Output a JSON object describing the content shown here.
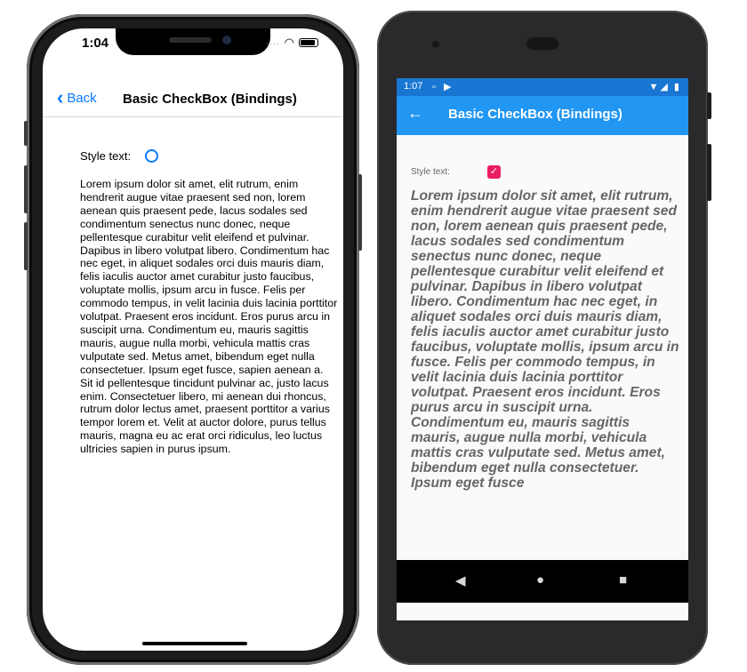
{
  "ios": {
    "status": {
      "time": "1:04"
    },
    "nav": {
      "back_label": "Back",
      "title": "Basic CheckBox (Bindings)"
    },
    "form": {
      "label": "Style text:",
      "checked": false
    },
    "body_text": "Lorem ipsum dolor sit amet, elit rutrum, enim hendrerit augue vitae praesent sed non, lorem aenean quis praesent pede, lacus sodales sed condimentum senectus nunc donec, neque pellentesque curabitur velit eleifend et pulvinar. Dapibus in libero volutpat libero. Condimentum hac nec eget, in aliquet sodales orci duis mauris diam, felis iaculis auctor amet curabitur justo faucibus, voluptate mollis, ipsum arcu in fusce. Felis per commodo tempus, in velit lacinia duis lacinia porttitor volutpat. Praesent eros incidunt. Eros purus arcu in suscipit urna. Condimentum eu, mauris sagittis mauris, augue nulla morbi, vehicula mattis cras vulputate sed. Metus amet, bibendum eget nulla consectetuer. Ipsum eget fusce, sapien aenean a. Sit id pellentesque tincidunt pulvinar ac, justo lacus enim. Consectetuer libero, mi aenean dui rhoncus, rutrum dolor lectus amet, praesent porttitor a varius tempor lorem et. Velit at auctor dolore, purus tellus mauris, magna eu ac erat orci ridiculus, leo luctus ultricies sapien in purus ipsum.",
    "colors": {
      "accent": "#0a7aff"
    }
  },
  "android": {
    "status": {
      "time": "1:07",
      "notif_icons": "▫ ▶",
      "right_icons": "▼◢ ▮"
    },
    "toolbar": {
      "back_icon": "←",
      "title": "Basic CheckBox (Bindings)"
    },
    "form": {
      "label": "Style text:",
      "checked": true,
      "check_glyph": "✓"
    },
    "body_text": "Lorem ipsum dolor sit amet, elit rutrum, enim hendrerit augue vitae praesent sed non, lorem aenean quis praesent pede, lacus sodales sed condimentum senectus nunc donec, neque pellentesque curabitur velit eleifend et pulvinar. Dapibus in libero volutpat libero. Condimentum hac nec eget, in aliquet sodales orci duis mauris diam, felis iaculis auctor amet curabitur justo faucibus, voluptate mollis, ipsum arcu in fusce. Felis per commodo tempus, in velit lacinia duis lacinia porttitor volutpat. Praesent eros incidunt. Eros purus arcu in suscipit urna. Condimentum eu, mauris sagittis mauris, augue nulla morbi, vehicula mattis cras vulputate sed. Metus amet, bibendum eget nulla consectetuer. Ipsum eget fusce",
    "nav": {
      "back": "◀",
      "home": "●",
      "recents": "■"
    },
    "colors": {
      "status_bar": "#1976d2",
      "toolbar": "#2196f3",
      "checkbox": "#e91e63"
    }
  }
}
